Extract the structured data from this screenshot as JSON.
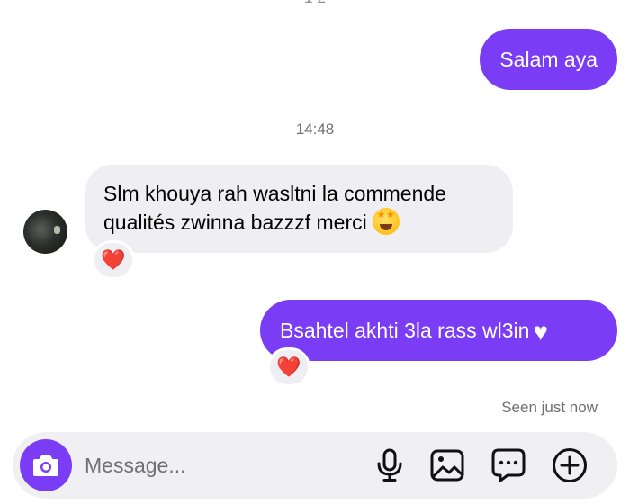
{
  "conversation": {
    "messages": [
      {
        "direction": "outgoing",
        "text": "Salam aya"
      },
      {
        "direction": "incoming",
        "text": "Slm khouya rah wasltni la commende qualités zwinna bazzzf merci",
        "emoji": "star-struck-emoji",
        "reaction": "❤️"
      },
      {
        "direction": "outgoing",
        "text": "Bsahtel akhti 3la rass wl3in",
        "emoji": "white-heart-emoji",
        "reaction": "❤️"
      }
    ],
    "timestamp": "14:48",
    "seen_status": "Seen just now"
  },
  "composer": {
    "placeholder": "Message...",
    "icons": [
      "camera-icon",
      "microphone-icon",
      "photo-icon",
      "sticker-chat-icon",
      "plus-icon"
    ]
  },
  "colors": {
    "outgoing_bubble": "#7a3cf5",
    "incoming_bubble": "#efeff3",
    "reaction_heart": "#e0162b"
  }
}
